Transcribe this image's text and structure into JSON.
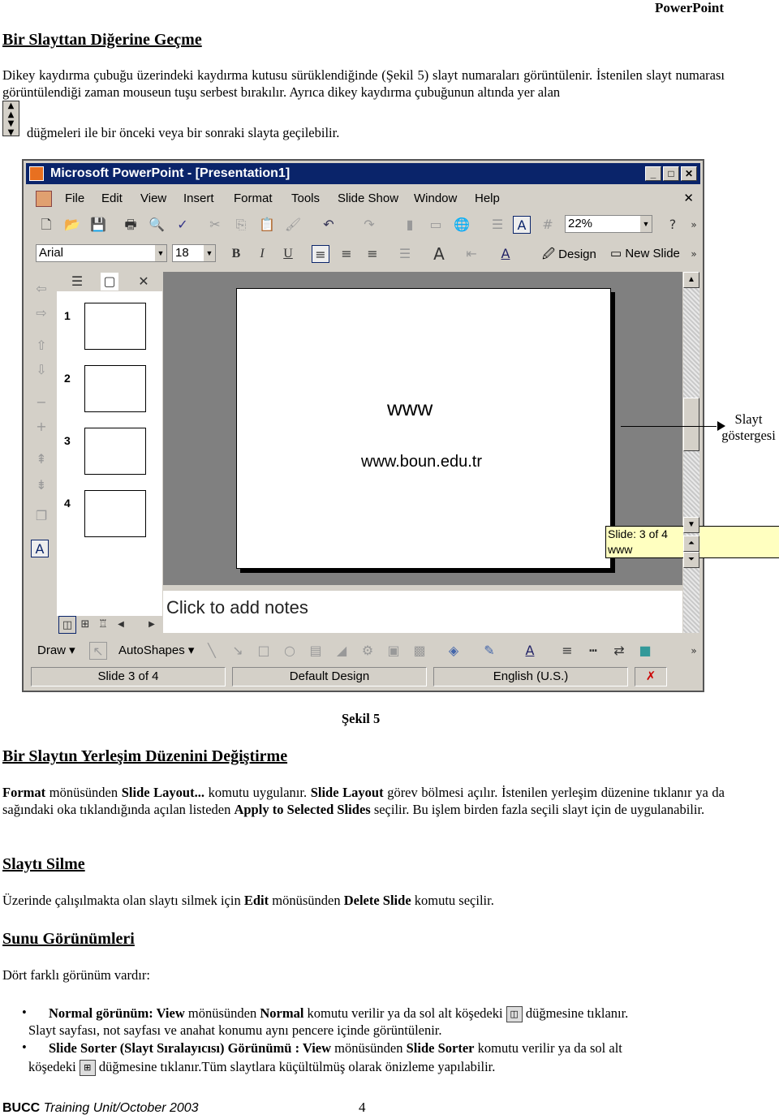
{
  "header": "PowerPoint",
  "s1": {
    "title": "Bir Slayttan Diğerine Geçme",
    "p1": "Dikey kaydırma çubuğu üzerindeki kaydırma kutusu sürüklendiğinde (Şekil 5) slayt numaraları görüntülenir. İstenilen slayt numarası görüntülendiği zaman mouseun tuşu serbest bırakılır. Ayrıca dikey kaydırma çubuğunun altında yer alan",
    "p2": "düğmeleri ile bir önceki veya  bir sonraki slayta geçilebilir."
  },
  "window": {
    "title": "Microsoft PowerPoint - [Presentation1]",
    "menu": [
      "File",
      "Edit",
      "View",
      "Insert",
      "Format",
      "Tools",
      "Slide Show",
      "Window",
      "Help"
    ],
    "zoom": "22%",
    "font": "Arial",
    "size": "18",
    "design": "Design",
    "new_slide": "New Slide",
    "thumbs": [
      "1",
      "2",
      "3",
      "4"
    ],
    "slide_title": "www",
    "slide_text": "www.boun.edu.tr",
    "tooltip_line1": "Slide: 3 of 4",
    "tooltip_line2": "www",
    "notes": "Click to add notes",
    "draw": "Draw",
    "autoshapes": "AutoShapes",
    "status": [
      "Slide 3 of 4",
      "Default Design",
      "English (U.S.)"
    ]
  },
  "callout": "Slayt göstergesi",
  "caption": "Şekil 5",
  "s2": {
    "title": "Bir Slaytın Yerleşim Düzenini Değiştirme",
    "t": [
      "Format",
      " mönüsünden ",
      "Slide Layout...",
      " komutu uygulanır. ",
      "Slide Layout",
      " görev bölmesi açılır. İstenilen yerleşim düzenine tıklanır ya da sağındaki oka tıklandığında açılan listeden ",
      "Apply to Selected Slides",
      " seçilir. Bu işlem birden fazla seçili slayt için de uygulanabilir."
    ]
  },
  "s3": {
    "title": "Slaytı Silme",
    "t": [
      "Üzerinde çalışılmakta olan slaytı silmek için ",
      "Edit",
      " mönüsünden ",
      "Delete Slide",
      " komutu seçilir."
    ]
  },
  "s4": {
    "title": "Sunu Görünümleri",
    "intro": "Dört farklı görünüm vardır:",
    "b1": [
      "Normal görünüm: View",
      " mönüsünden ",
      "Normal",
      " komutu verilir ya da sol alt köşedeki ",
      "düğmesine tıklanır."
    ],
    "b1b": "Slayt sayfası, not sayfası ve anahat konumu aynı pencere içinde görüntülenir.",
    "b2": [
      "Slide Sorter (Slayt Sıralayıcısı) Görünümü : View",
      " mönüsünden ",
      "Slide Sorter",
      " komutu verilir ya da sol alt"
    ],
    "b2b": [
      "köşedeki ",
      "düğmesine tıklanır.Tüm slaytlara küçültülmüş olarak önizleme yapılabilir."
    ]
  },
  "footer": {
    "org": "BUCC",
    "rest": " Training Unit/October 2003",
    "page": "4"
  }
}
